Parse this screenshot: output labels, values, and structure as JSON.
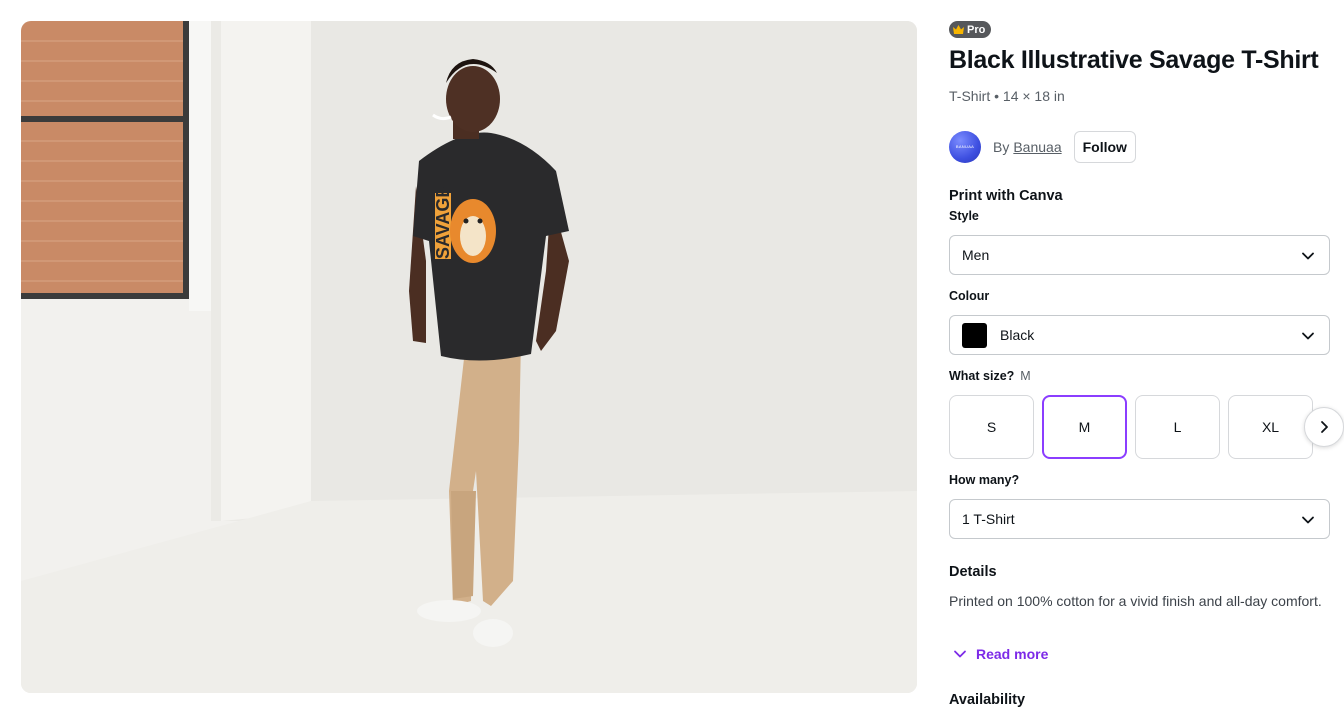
{
  "product": {
    "badge": "Pro",
    "title": "Black Illustrative Savage T-Shirt",
    "subtitle": "T-Shirt • 14 × 18 in",
    "image_alt": "Man wearing a black t-shirt with a tiger graphic",
    "shirt_print_text": "SAVAGE"
  },
  "creator": {
    "avatar_text": "BANUAA",
    "by_label": "By",
    "name": "Banuaa",
    "follow_label": "Follow"
  },
  "print": {
    "heading": "Print with Canva",
    "style_label": "Style",
    "style_value": "Men",
    "colour_label": "Colour",
    "colour_value": "Black",
    "colour_hex": "#000000",
    "size_label": "What size?",
    "size_selected": "M",
    "sizes": [
      "S",
      "M",
      "L",
      "XL"
    ],
    "quantity_label": "How many?",
    "quantity_value": "1 T-Shirt"
  },
  "details": {
    "heading": "Details",
    "text": "Printed on 100% cotton for a vivid finish and all-day comfort.",
    "read_more_label": "Read more"
  },
  "availability": {
    "heading": "Availability"
  },
  "colors": {
    "accent": "#8b3dff",
    "link": "#7d2ae8",
    "pro_badge": "#56585b"
  },
  "icons": {
    "crown": "crown-icon",
    "chevron_down": "chevron-down-icon",
    "chevron_right": "chevron-right-icon"
  }
}
